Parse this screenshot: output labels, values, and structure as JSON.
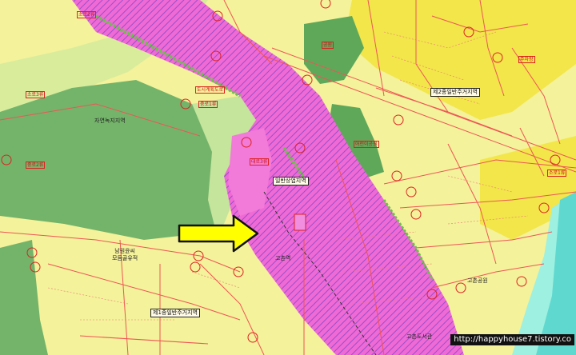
{
  "zones": {
    "nature_green": "자연녹지지역",
    "commercial": "일반상업지역",
    "residential_2": "제2종일반주거지역",
    "residential_1": "제1종일반주거지역"
  },
  "places": {
    "park": "남원윤씨\n모듬골유적",
    "subway_label": "고촌역",
    "tenth": "고촌공원",
    "tenth2": "고촌도서관"
  },
  "red_codes": [
    "소로2류",
    "중로1류",
    "도시계획도로",
    "어린이공원",
    "공원",
    "소로3류",
    "중로2류",
    "대로3류",
    "소로1류",
    "주차장"
  ],
  "watermark": "http://happyhouse7.tistory.co",
  "colors": {
    "residential_yellow": "#f4f29a",
    "residential_deep": "#f2e64a",
    "green": "#74b46a",
    "light_green": "#c5e49c",
    "commercial_pink": "#f06ad6",
    "road_line": "#e55",
    "arrow": "#ffff00"
  },
  "icons": {
    "arrow": "right-arrow-icon"
  }
}
